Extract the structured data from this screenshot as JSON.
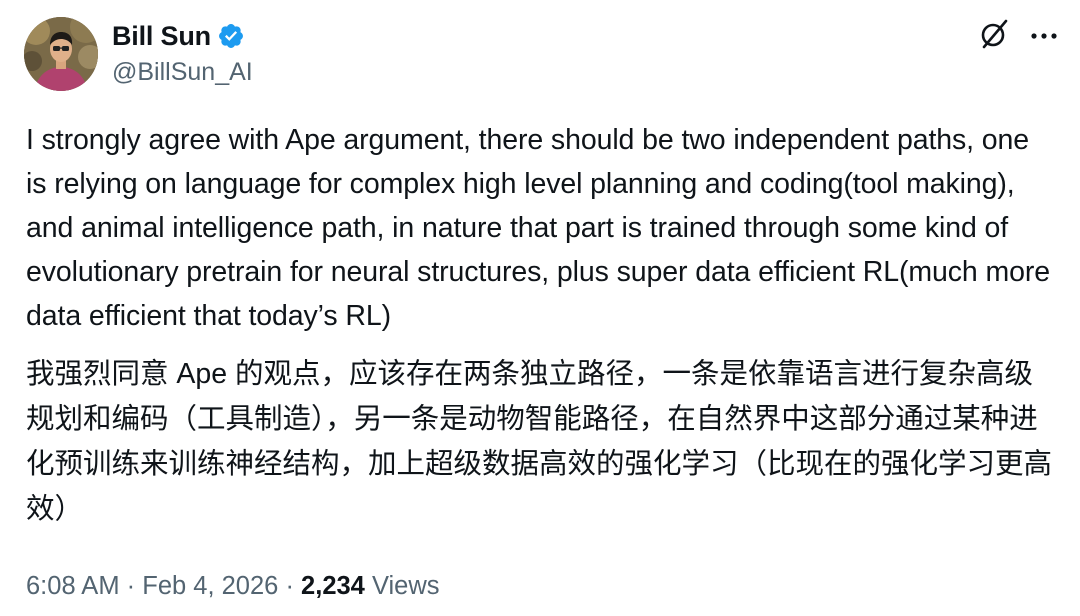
{
  "author": {
    "display_name": "Bill Sun",
    "handle": "@BillSun_AI",
    "verified_color": "#1d9bf0"
  },
  "icons": {
    "grok": "grok-icon",
    "more": "more-icon",
    "verified": "verified-badge-icon"
  },
  "tweet": {
    "text_en": "I strongly agree with Ape argument, there should be two independent paths, one is relying on language for complex high level planning and coding(tool making), and animal intelligence path, in nature that part is trained through some kind of evolutionary pretrain for neural structures, plus super data efficient RL(much more data efficient that today’s RL)",
    "text_zh": "我强烈同意 Ape 的观点，应该存在两条独立路径，一条是依靠语言进行复杂高级规划和编码（工具制造），另一条是动物智能路径，在自然界中这部分通过某种进化预训练来训练神经结构，加上超级数据高效的强化学习（比现在的强化学习更高效）"
  },
  "meta": {
    "time": "6:08 AM",
    "separator": "·",
    "date": "Feb 4, 2026",
    "views_count": "2,234",
    "views_label": "Views"
  },
  "colors": {
    "text_primary": "#0f1419",
    "text_secondary": "#536471",
    "accent": "#1d9bf0"
  }
}
